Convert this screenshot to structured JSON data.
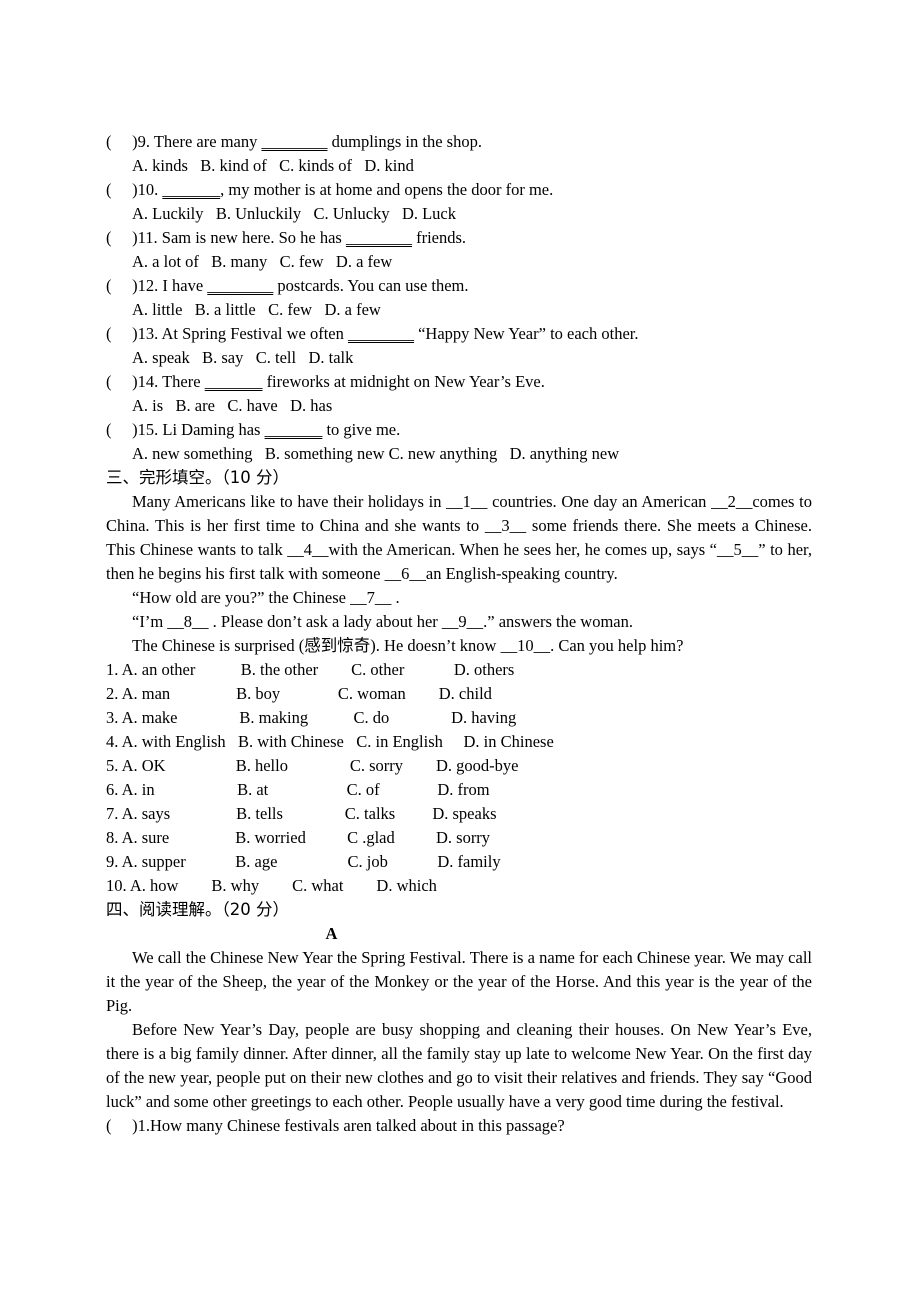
{
  "document": {
    "type": "english-exam-paper",
    "language": "en-zh"
  },
  "multiple_choice": {
    "questions": [
      {
        "marker": "(     )",
        "number": "9.",
        "stem_before": " There are many ",
        "blank": "________",
        "stem_after": " dumplings in the shop.",
        "options": "A. kinds   B. kind of   C. kinds of   D. kind"
      },
      {
        "marker": "(     )",
        "number": "10.",
        "stem_before": " ",
        "blank": "_______",
        "stem_after": ", my mother is at home and opens the door for me.",
        "options": "A. Luckily   B. Unluckily   C. Unlucky   D. Luck"
      },
      {
        "marker": "(     )",
        "number": "11.",
        "stem_before": " Sam is new here. So he has ",
        "blank": "________",
        "stem_after": " friends.",
        "options": "A. a lot of   B. many   C. few   D. a few"
      },
      {
        "marker": "(     )",
        "number": "12.",
        "stem_before": " I have ",
        "blank": "________",
        "stem_after": " postcards. You can use them.",
        "options": "A. little   B. a little   C. few   D. a few"
      },
      {
        "marker": "(     )",
        "number": "13.",
        "stem_before": " At Spring Festival we often ",
        "blank": "________",
        "stem_after": " “Happy New Year” to each other.",
        "options": "A. speak   B. say   C. tell   D. talk"
      },
      {
        "marker": "(     )",
        "number": "14.",
        "stem_before": " There ",
        "blank": "_______",
        "stem_after": " fireworks at midnight on New Year’s Eve.",
        "options": "A. is   B. are   C. have   D. has"
      },
      {
        "marker": "(     )",
        "number": "15.",
        "stem_before": " Li Daming has ",
        "blank": "_______",
        "stem_after": " to give me.",
        "options": "A. new something   B. something new C. new anything   D. anything new"
      }
    ]
  },
  "cloze_section": {
    "heading": "三、完形填空。（10 分）",
    "passage_paragraph": "Many Americans like to have their holidays in __1__ countries. One day an American __2__comes to China. This is her first time to China and she wants to __3__ some friends there. She meets a Chinese. This Chinese wants to talk __4__with the American. When he sees her, he comes up, says “__5__” to her, then he begins his first talk with someone __6__an English-speaking country.",
    "dialogue_lines": [
      "“How old are you?” the Chinese __7__ .",
      "“I’m __8__ . Please don’t ask a lady about her __9__.” answers the woman.",
      "The Chinese is surprised (感到惊奇). He doesn’t know __10__.   Can you help him?"
    ],
    "option_rows": [
      {
        "number": "1.",
        "a": "A. an other",
        "b": "B. the other",
        "c": "C. other",
        "d": "D. others"
      },
      {
        "number": "2.",
        "a": "A. man",
        "b": "B. boy",
        "c": "C. woman",
        "d": "D. child"
      },
      {
        "number": "3.",
        "a": "A. make",
        "b": "B. making",
        "c": "C. do",
        "d": "D. having"
      },
      {
        "number": "4.",
        "a": "A. with English",
        "b": "B. with Chinese",
        "c": "C. in English",
        "d": "D. in Chinese"
      },
      {
        "number": "5.",
        "a": "A. OK",
        "b": "B. hello",
        "c": "C. sorry",
        "d": "D. good-bye"
      },
      {
        "number": "6.",
        "a": "A. in",
        "b": "B. at",
        "c": "C. of",
        "d": "D. from"
      },
      {
        "number": "7.",
        "a": "A. says",
        "b": "B. tells",
        "c": "C. talks",
        "d": "D. speaks"
      },
      {
        "number": "8.",
        "a": "A. sure",
        "b": "B. worried",
        "c": "C .glad",
        "d": "D. sorry"
      },
      {
        "number": "9.",
        "a": "A. supper",
        "b": "B. age",
        "c": "C. job",
        "d": "D. family"
      },
      {
        "number": "10.",
        "a": "A. how",
        "b": "B. why",
        "c": "C. what",
        "d": "D. which"
      }
    ],
    "option_rows_raw": [
      "1. A. an other           B. the other        C. other            D. others",
      "2. A. man                B. boy              C. woman        D. child",
      "3. A. make               B. making           C. do               D. having",
      "4. A. with English   B. with Chinese   C. in English     D. in Chinese",
      "5. A. OK                 B. hello               C. sorry        D. good-bye",
      "6. A. in                    B. at                   C. of              D. from",
      "7. A. says                B. tells               C. talks         D. speaks",
      "8. A. sure                B. worried          C .glad          D. sorry",
      "9. A. supper            B. age                 C. job            D. family",
      "10. A. how        B. why        C. what        D. which"
    ]
  },
  "reading_section": {
    "heading": "四、阅读理解。（20 分）",
    "passage_label": "A",
    "paragraphs": [
      "We call the Chinese New Year the Spring Festival. There is a name for each Chinese year. We may call it the year of the Sheep, the year of the Monkey or the year of the Horse. And this year is the year of the Pig.",
      "Before New Year’s Day, people are busy shopping and cleaning their houses. On New Year’s Eve, there is a big family dinner. After dinner, all the family stay up late to welcome New Year. On the first day of the new year, people put on their new clothes and go to visit their relatives and friends. They say “Good luck” and some other greetings to each other. People usually have a very good time during the festival."
    ],
    "question": {
      "marker": "(     )",
      "text": "1.How many Chinese festivals aren talked about in this passage?"
    }
  }
}
